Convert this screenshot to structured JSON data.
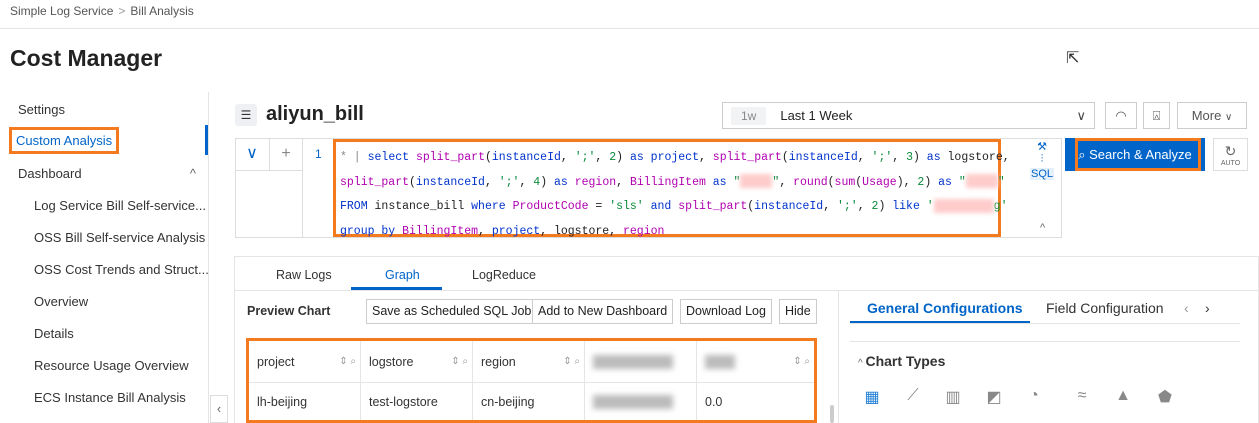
{
  "breadcrumb": [
    "Simple Log Service",
    "Bill Analysis"
  ],
  "breadcrumb_sep": ">",
  "page_title": "Cost Manager",
  "sidebar": {
    "items": [
      {
        "label": "Settings"
      },
      {
        "label": "Custom Analysis"
      },
      {
        "label": "Dashboard"
      },
      {
        "label": "Log Service Bill Self-service..."
      },
      {
        "label": "OSS Bill Self-service Analysis"
      },
      {
        "label": "OSS Cost Trends and Struct..."
      },
      {
        "label": "Overview"
      },
      {
        "label": "Details"
      },
      {
        "label": "Resource Usage Overview"
      },
      {
        "label": "ECS Instance Bill Analysis"
      }
    ]
  },
  "logstore": {
    "name": "aliyun_bill"
  },
  "time_picker": {
    "quick": "1w",
    "label": "Last 1 Week"
  },
  "toolbar": {
    "more": "More"
  },
  "editor": {
    "line_number": "1",
    "sql_badge": "SQL",
    "search_label": "Search & Analyze",
    "auto_label": "AUTO"
  },
  "tabs": [
    "Raw Logs",
    "Graph",
    "LogReduce"
  ],
  "preview": {
    "title": "Preview Chart",
    "buttons": [
      "Save as Scheduled SQL Job",
      "Add to New Dashboard",
      "Download Log",
      "Hide"
    ]
  },
  "table": {
    "headers": [
      "project",
      "logstore",
      "region"
    ],
    "row": [
      "lh-beijing",
      "test-logstore",
      "cn-beijing",
      "0.0"
    ]
  },
  "right": {
    "tabs": [
      "General Configurations",
      "Field Configuration"
    ],
    "chart_types": "Chart Types"
  },
  "colors": {
    "accent": "#0064c8",
    "highlight": "#f47a20"
  }
}
